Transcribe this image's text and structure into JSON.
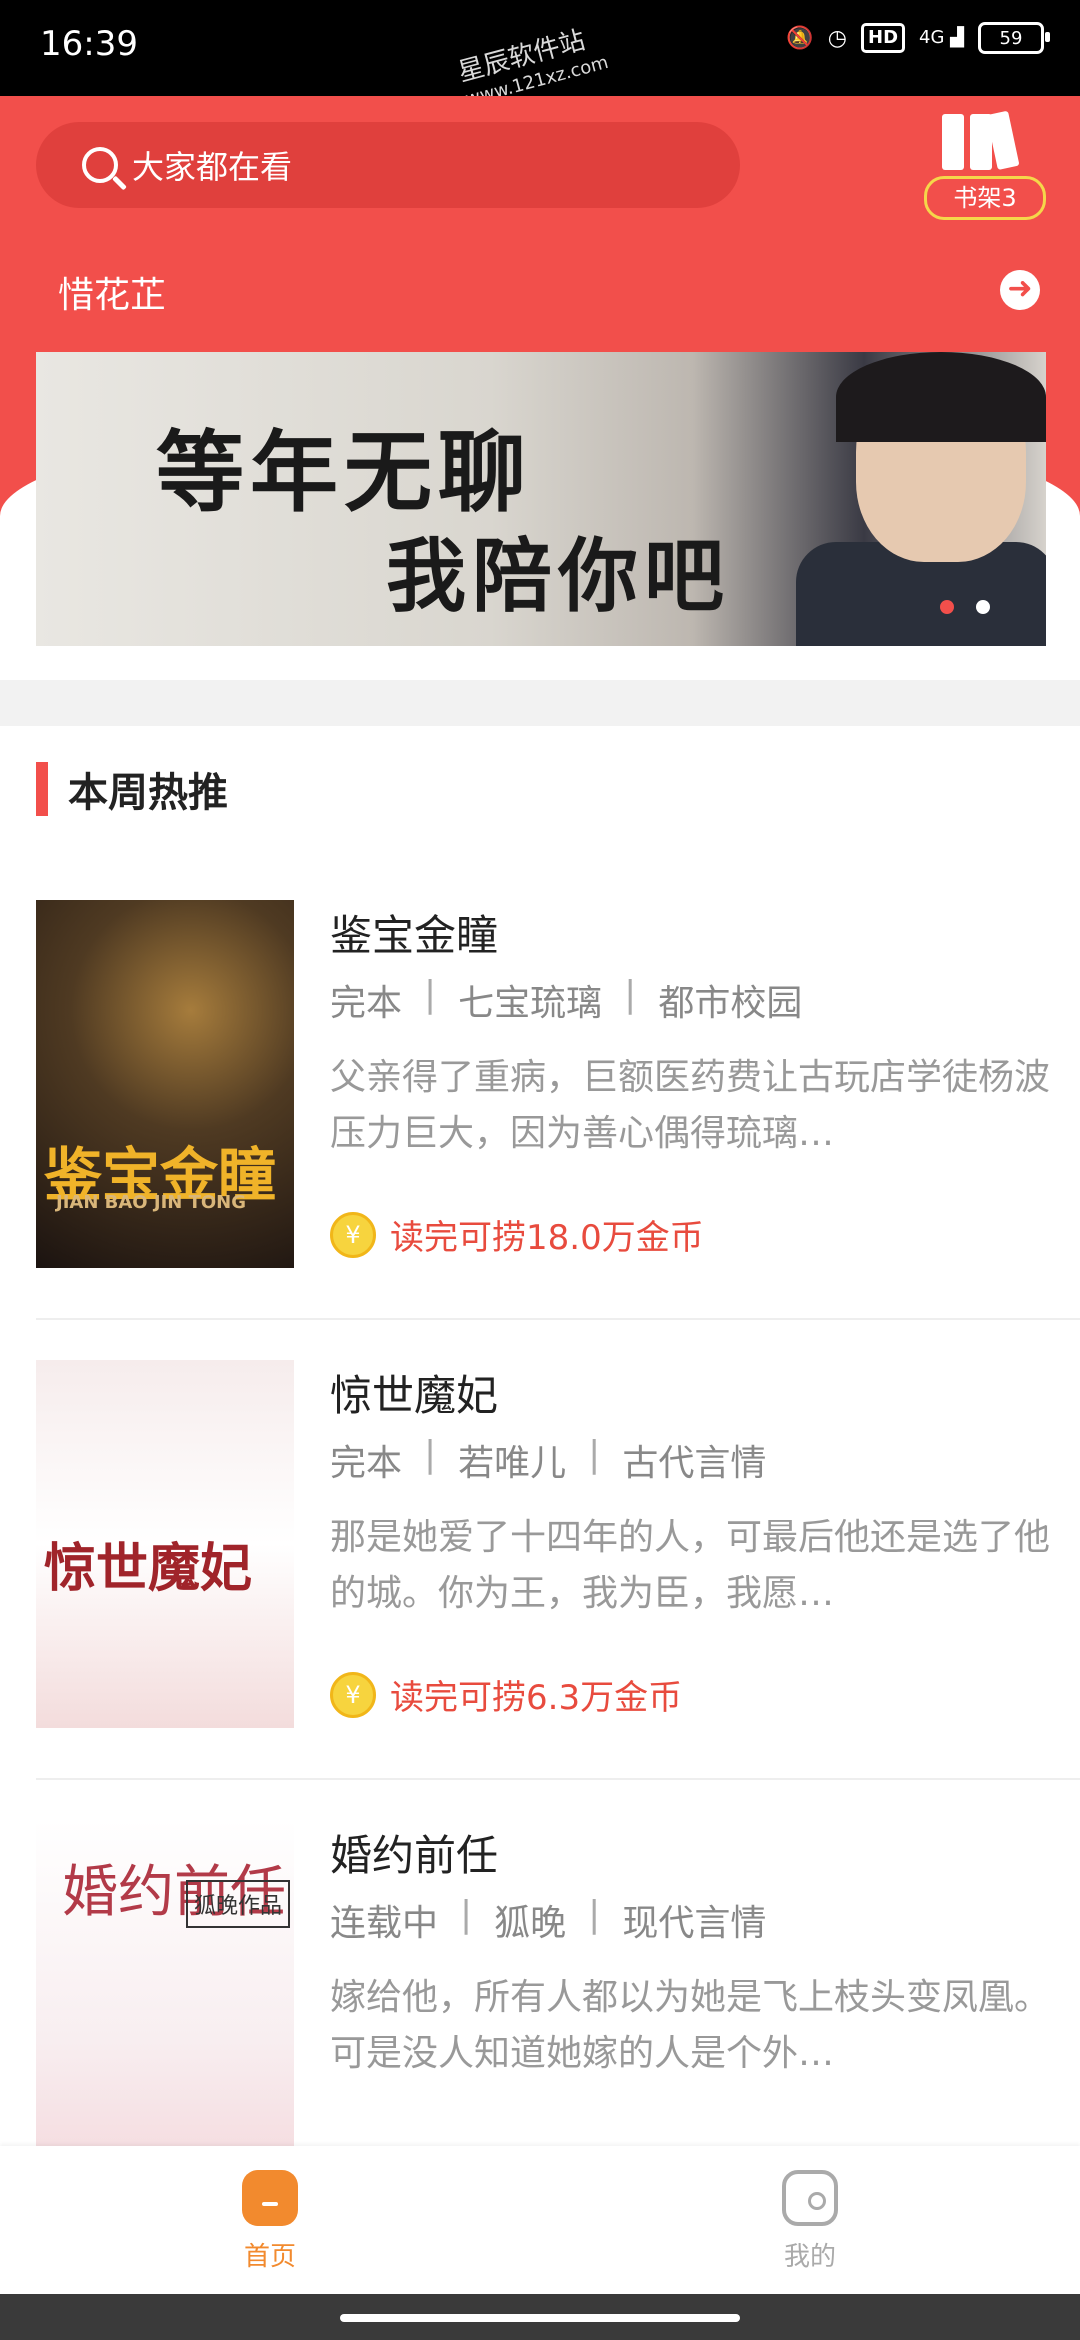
{
  "status_bar": {
    "time": "16:39",
    "icons": [
      "bell-muted-icon",
      "alarm-icon",
      "hd-icon",
      "signal-icon",
      "battery-icon"
    ],
    "hd_label": "HD",
    "network": "4G",
    "battery": "59"
  },
  "watermark": {
    "line1": "星辰软件站",
    "line2": "www.121xz.com"
  },
  "header": {
    "search_placeholder": "大家都在看",
    "bookshelf_label": "书架3",
    "notice_text": "惜花芷",
    "accent_color": "#f24f4b"
  },
  "banner": {
    "line1": "等年无聊",
    "line2": "我陪你吧",
    "dots_total": 2,
    "active_dot": 1
  },
  "section": {
    "title": "本周热推"
  },
  "books": [
    {
      "title": "鉴宝金瞳",
      "status": "完本",
      "author": "七宝琉璃",
      "category": "都市校园",
      "description": "父亲得了重病，巨额医药费让古玩店学徒杨波压力巨大，因为善心偶得琉璃…",
      "reward": "读完可捞18.0万金币",
      "cover_title": "鉴宝金瞳",
      "cover_sub": "JIAN BAO JIN TONG"
    },
    {
      "title": "惊世魔妃",
      "status": "完本",
      "author": "若唯儿",
      "category": "古代言情",
      "description": "那是她爱了十四年的人，可最后他还是选了他的城。你为王，我为臣，我愿…",
      "reward": "读完可捞6.3万金币",
      "cover_title": "惊世魔妃"
    },
    {
      "title": "婚约前任",
      "status": "连载中",
      "author": "狐晚",
      "category": "现代言情",
      "description": "嫁给他，所有人都以为她是飞上枝头变凤凰。可是没人知道她嫁的人是个外…",
      "reward": "",
      "cover_title": "婚约前任",
      "cover_author": "狐晚作品"
    }
  ],
  "separator": "|",
  "coin_symbol": "¥",
  "tabbar": {
    "home_label": "首页",
    "mine_label": "我的",
    "active_color": "#f28a2e"
  }
}
